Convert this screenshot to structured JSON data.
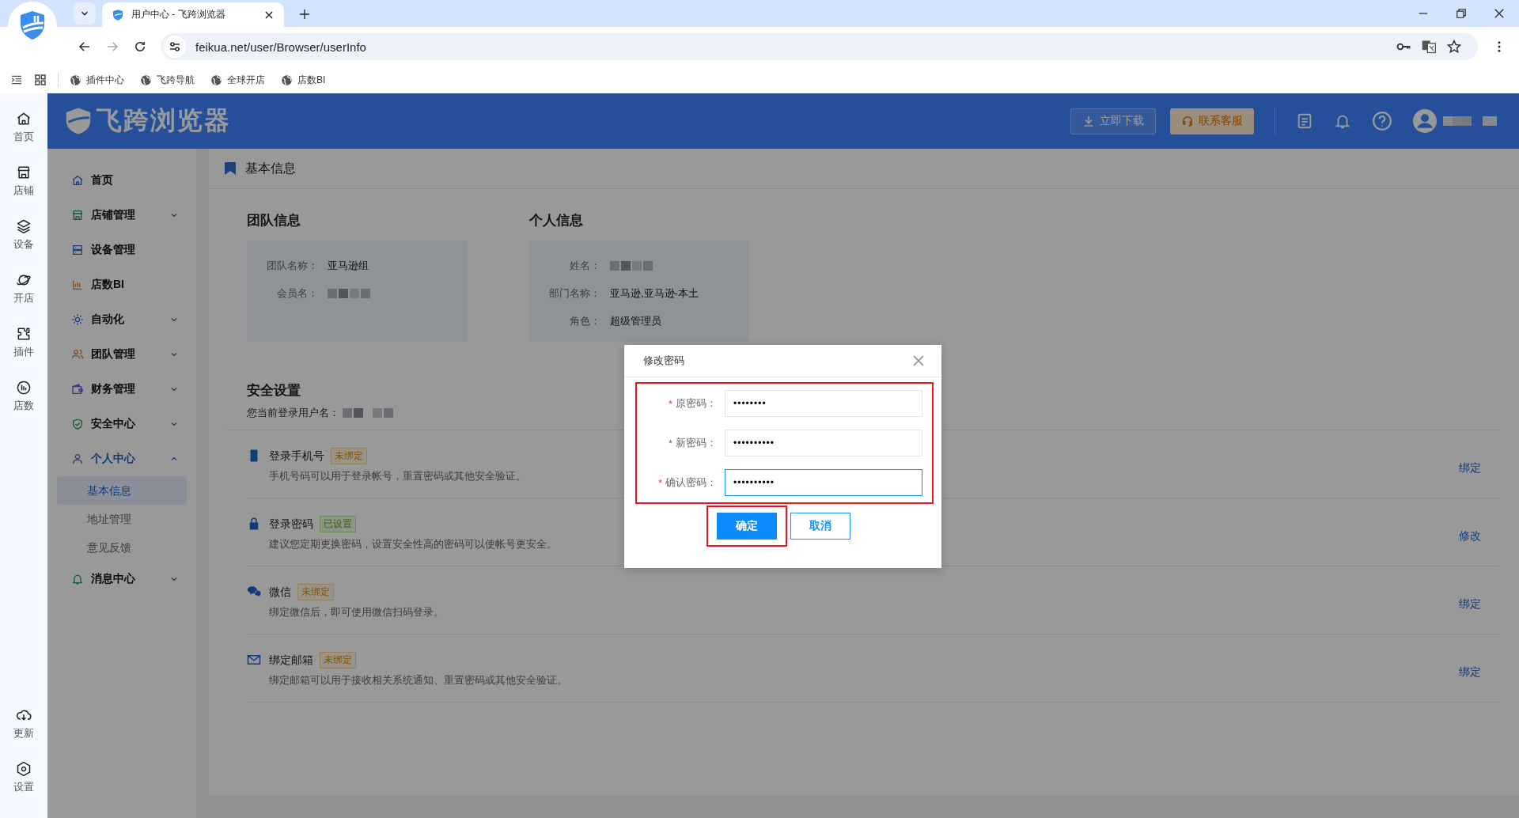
{
  "browser": {
    "tab_title": "用户中心 - 飞跨浏览器",
    "url": "feikua.net/user/Browser/userInfo",
    "forward_disabled": true,
    "bookmarks": [
      "插件中心",
      "飞跨导航",
      "全球开店",
      "店数BI"
    ]
  },
  "rail": {
    "items": [
      {
        "label": "首页",
        "kind": "home"
      },
      {
        "label": "店铺",
        "kind": "store"
      },
      {
        "label": "设备",
        "kind": "layers"
      },
      {
        "label": "开店",
        "kind": "planet"
      },
      {
        "label": "插件",
        "kind": "puzzle"
      },
      {
        "label": "店数",
        "kind": "bi"
      }
    ],
    "bottom_items": [
      {
        "label": "更新",
        "kind": "cloud"
      },
      {
        "label": "设置",
        "kind": "gear"
      }
    ]
  },
  "header": {
    "logo": "飞跨浏览器",
    "download_button": "立即下载",
    "support_button": "联系客服",
    "user_redacted": true
  },
  "nav": {
    "items": [
      {
        "label": "首页",
        "kind": "home",
        "expandable": false,
        "selected": false
      },
      {
        "label": "店铺管理",
        "kind": "store",
        "expandable": true,
        "expanded": false,
        "selected": false
      },
      {
        "label": "设备管理",
        "kind": "server",
        "expandable": false,
        "selected": false
      },
      {
        "label": "店数BI",
        "kind": "chart",
        "expandable": false,
        "selected": false
      },
      {
        "label": "自动化",
        "kind": "sun",
        "expandable": true,
        "expanded": false,
        "selected": false
      },
      {
        "label": "团队管理",
        "kind": "team",
        "expandable": true,
        "expanded": false,
        "selected": false
      },
      {
        "label": "财务管理",
        "kind": "wallet",
        "expandable": true,
        "expanded": false,
        "selected": false
      },
      {
        "label": "安全中心",
        "kind": "shield",
        "expandable": true,
        "expanded": false,
        "selected": false
      },
      {
        "label": "个人中心",
        "kind": "user",
        "expandable": true,
        "expanded": true,
        "selected": true,
        "children": [
          {
            "label": "基本信息",
            "selected": true
          },
          {
            "label": "地址管理",
            "selected": false
          },
          {
            "label": "意见反馈",
            "selected": false
          }
        ]
      },
      {
        "label": "消息中心",
        "kind": "bell",
        "expandable": true,
        "expanded": false,
        "selected": false
      }
    ]
  },
  "page": {
    "title": "基本信息",
    "team": {
      "title": "团队信息",
      "fields": [
        {
          "label": "团队名称：",
          "value": "亚马逊组",
          "redacted": false
        },
        {
          "label": "会员名：",
          "redacted": true
        }
      ]
    },
    "personal": {
      "title": "个人信息",
      "fields": [
        {
          "label": "姓名：",
          "redacted": true
        },
        {
          "label": "部门名称：",
          "value": "亚马逊,亚马逊-本土",
          "redacted": false
        },
        {
          "label": "角色：",
          "value": "超级管理员",
          "redacted": false
        }
      ]
    },
    "security": {
      "title": "安全设置",
      "username_label": "您当前登录用户名：",
      "username_redacted": true,
      "items": [
        {
          "kind": "phone",
          "title": "登录手机号",
          "tag": {
            "label": "未绑定",
            "kind": "warning"
          },
          "description": "手机号码可以用于登录帐号，重置密码或其他安全验证。",
          "action": "绑定"
        },
        {
          "kind": "lock",
          "title": "登录密码",
          "tag": {
            "label": "已设置",
            "kind": "success"
          },
          "description": "建议您定期更换密码，设置安全性高的密码可以使帐号更安全。",
          "action": "修改"
        },
        {
          "kind": "wechat",
          "title": "微信",
          "tag": {
            "label": "未绑定",
            "kind": "warning"
          },
          "description": "绑定微信后，即可使用微信扫码登录。",
          "action": "绑定"
        },
        {
          "kind": "mail",
          "title": "绑定邮箱",
          "tag": {
            "label": "未绑定",
            "kind": "warning"
          },
          "description": "绑定邮箱可以用于接收相关系统通知、重置密码或其他安全验证。",
          "action": "绑定"
        }
      ]
    }
  },
  "dialog": {
    "title": "修改密码",
    "form_highlighted": true,
    "fields": [
      {
        "label": "原密码：",
        "required_mark": "*",
        "value": "••••••••",
        "focused": false
      },
      {
        "label": "新密码：",
        "required_mark": "*",
        "value": "••••••••••",
        "focused": false
      },
      {
        "label": "确认密码：",
        "required_mark": "*",
        "value": "••••••••••",
        "focused": true
      }
    ],
    "confirm": {
      "label": "确定",
      "highlighted": true
    },
    "cancel": "取消"
  }
}
